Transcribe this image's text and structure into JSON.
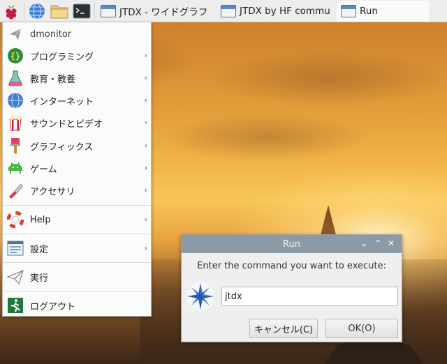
{
  "taskbar": {
    "windows": [
      {
        "label": "JTDX - ワイドグラフ"
      },
      {
        "label": "JTDX  by HF commu"
      },
      {
        "label": "Run"
      }
    ]
  },
  "menu": {
    "header": "dmonitor",
    "items": [
      {
        "label": "プログラミング",
        "icon": "programming-icon"
      },
      {
        "label": "教育・教養",
        "icon": "education-icon"
      },
      {
        "label": "インターネット",
        "icon": "globe-icon"
      },
      {
        "label": "サウンドとビデオ",
        "icon": "popcorn-icon"
      },
      {
        "label": "グラフィックス",
        "icon": "paintbrush-icon"
      },
      {
        "label": "ゲーム",
        "icon": "game-invader-icon"
      },
      {
        "label": "アクセサリ",
        "icon": "knife-icon"
      }
    ],
    "help": "Help",
    "settings": "設定",
    "run": "実行",
    "logout": "ログアウト"
  },
  "dialog": {
    "title": "Run",
    "prompt": "Enter the command you want to execute:",
    "input_value": "jtdx",
    "cancel_label": "キャンセル(C)",
    "ok_label": "OK(O)"
  }
}
